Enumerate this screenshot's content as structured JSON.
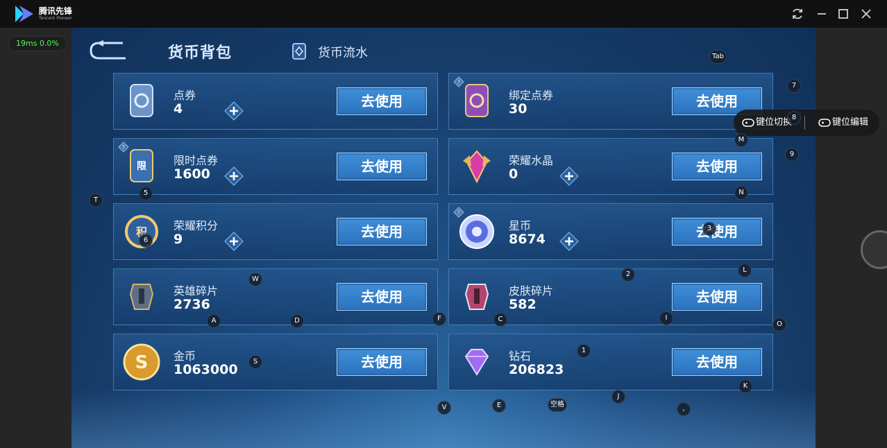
{
  "app": {
    "name": "腾讯先锋",
    "subtitle": "Tencent Pioneer",
    "perf": "19ms  0.0%"
  },
  "window_controls": [
    "refresh-icon",
    "minimize-icon",
    "maximize-icon",
    "close-icon"
  ],
  "header": {
    "active_tab": "货币背包",
    "other_tab": "货币流水"
  },
  "currencies": [
    {
      "name": "点券",
      "value": "4",
      "button": "去使用",
      "icon": "coupon-icon",
      "plus": true,
      "help": false
    },
    {
      "name": "绑定点券",
      "value": "30",
      "button": "去使用",
      "icon": "bound-coupon-icon",
      "plus": false,
      "help": true
    },
    {
      "name": "限时点券",
      "value": "1600",
      "button": "去使用",
      "icon": "limited-coupon-icon",
      "plus": true,
      "help": true
    },
    {
      "name": "荣耀水晶",
      "value": "0",
      "button": "去使用",
      "icon": "glory-crystal-icon",
      "plus": true,
      "help": false
    },
    {
      "name": "荣耀积分",
      "value": "9",
      "button": "去使用",
      "icon": "glory-points-icon",
      "plus": true,
      "help": false
    },
    {
      "name": "星币",
      "value": "8674",
      "button": "去使用",
      "icon": "star-coin-icon",
      "plus": true,
      "help": true
    },
    {
      "name": "英雄碎片",
      "value": "2736",
      "button": "去使用",
      "icon": "hero-fragment-icon",
      "plus": false,
      "help": false
    },
    {
      "name": "皮肤碎片",
      "value": "582",
      "button": "去使用",
      "icon": "skin-fragment-icon",
      "plus": false,
      "help": false
    },
    {
      "name": "金币",
      "value": "1063000",
      "button": "去使用",
      "icon": "gold-coin-icon",
      "plus": false,
      "help": false
    },
    {
      "name": "钻石",
      "value": "206823",
      "button": "去使用",
      "icon": "diamond-icon",
      "plus": false,
      "help": false
    }
  ],
  "keypad": {
    "switch_label": "键位切换",
    "edit_label": "键位编辑"
  },
  "key_hints": [
    "Tab",
    "7",
    "8",
    "M",
    "9",
    "5",
    "T",
    "N",
    "3",
    "6",
    "2",
    "L",
    "W",
    "A",
    "D",
    "F",
    "C",
    "I",
    "O",
    "S",
    "1",
    "K",
    "V",
    "E",
    "空格",
    "J",
    ","
  ],
  "colors": {
    "background_blue": "#1d4d82",
    "button_blue": "#3f8fd8",
    "perf_green": "#4cff58"
  }
}
